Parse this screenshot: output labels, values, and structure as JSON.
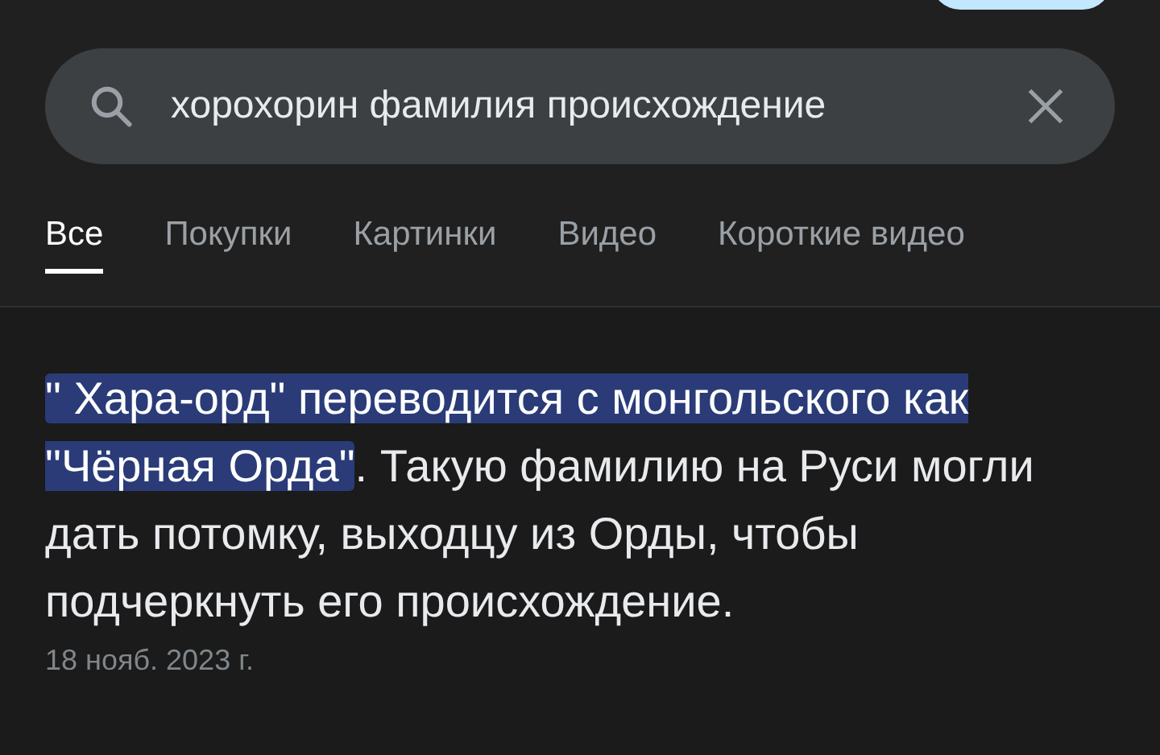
{
  "search": {
    "value": "хорохорин фамилия происхождение"
  },
  "tabs": [
    {
      "label": "Все",
      "selected": true
    },
    {
      "label": "Покупки",
      "selected": false
    },
    {
      "label": "Картинки",
      "selected": false
    },
    {
      "label": "Видео",
      "selected": false
    },
    {
      "label": "Короткие видео",
      "selected": false
    }
  ],
  "result": {
    "highlighted": "\" Хара-орд\" переводится с монгольского как \"Чёрная Орда\"",
    "text": ". Такую фамилию на Руси могли дать потомку, выходцу из Орды, чтобы подчеркнуть его происхождение.",
    "date": "18 нояб. 2023 г."
  }
}
